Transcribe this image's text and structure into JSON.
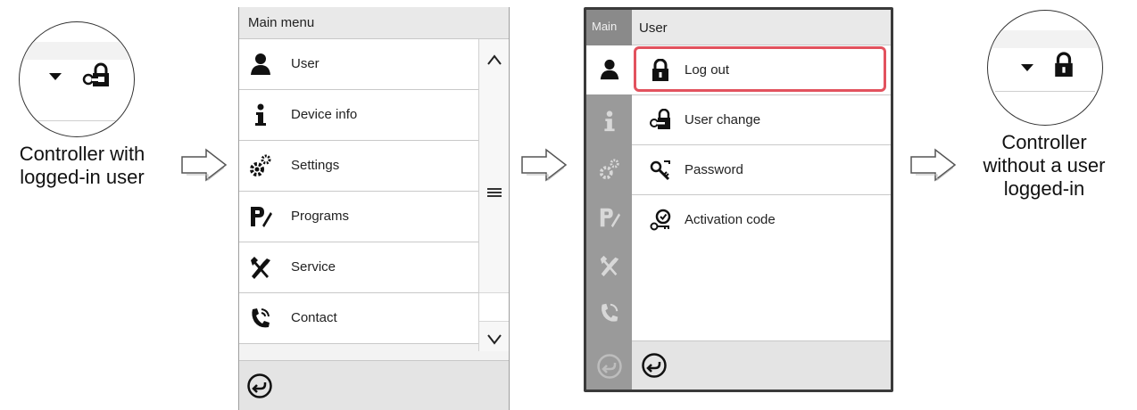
{
  "left_panel": {
    "caption_line1": "Controller with",
    "caption_line2": "logged-in user",
    "icons": [
      "caret-down-icon",
      "key-padlock-icon"
    ]
  },
  "main_menu": {
    "title": "Main menu",
    "items": [
      {
        "label": "User",
        "icon": "user-icon"
      },
      {
        "label": "Device info",
        "icon": "info-icon"
      },
      {
        "label": "Settings",
        "icon": "gears-icon"
      },
      {
        "label": "Programs",
        "icon": "programs-icon"
      },
      {
        "label": "Service",
        "icon": "service-tools-icon"
      },
      {
        "label": "Contact",
        "icon": "phone-icon"
      }
    ],
    "scroll": {
      "up": "chevron-up-icon",
      "handle": "drag-handle-icon",
      "down": "chevron-down-icon"
    },
    "back_icon": "back-arrow-icon"
  },
  "user_menu": {
    "side_title": "Main",
    "title": "User",
    "items": [
      {
        "label": "Log out",
        "icon": "padlock-icon",
        "highlighted": true
      },
      {
        "label": "User change",
        "icon": "key-padlock-icon"
      },
      {
        "label": "Password",
        "icon": "key-icon"
      },
      {
        "label": "Activation code",
        "icon": "activation-key-icon"
      }
    ],
    "highlight_color": "#e2525e",
    "back_icon": "back-arrow-icon"
  },
  "right_panel": {
    "caption_line1": "Controller",
    "caption_line2": "without a user",
    "caption_line3": "logged-in",
    "icons": [
      "caret-down-icon",
      "padlock-icon"
    ]
  }
}
